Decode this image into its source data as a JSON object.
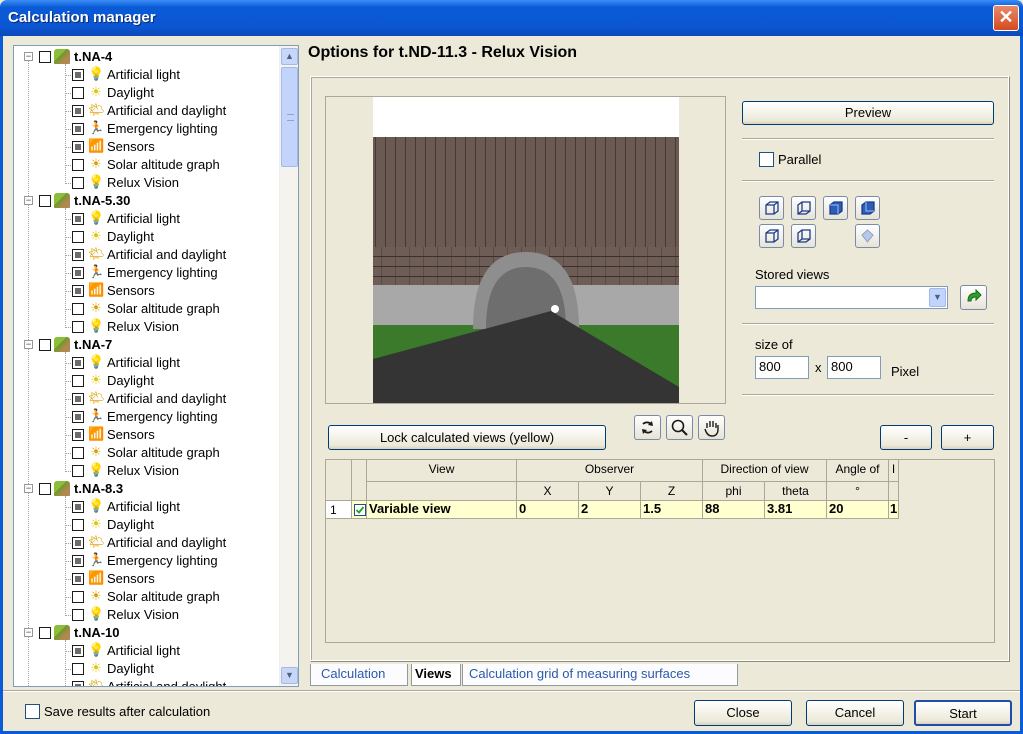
{
  "window": {
    "title": "Calculation manager"
  },
  "tree": {
    "projects": [
      {
        "label": "t.NA-4",
        "children": [
          "Artificial light",
          "Daylight",
          "Artificial and daylight",
          "Emergency lighting",
          "Sensors",
          "Solar altitude graph",
          "Relux Vision"
        ]
      },
      {
        "label": "t.NA-5.30",
        "children": [
          "Artificial light",
          "Daylight",
          "Artificial and daylight",
          "Emergency lighting",
          "Sensors",
          "Solar altitude graph",
          "Relux Vision"
        ]
      },
      {
        "label": "t.NA-7",
        "children": [
          "Artificial light",
          "Daylight",
          "Artificial and daylight",
          "Emergency lighting",
          "Sensors",
          "Solar altitude graph",
          "Relux Vision"
        ]
      },
      {
        "label": "t.NA-8.3",
        "children": [
          "Artificial light",
          "Daylight",
          "Artificial and daylight",
          "Emergency lighting",
          "Sensors",
          "Solar altitude graph",
          "Relux Vision"
        ]
      },
      {
        "label": "t.NA-10",
        "children": [
          "Artificial light",
          "Daylight",
          "Artificial and daylight"
        ]
      }
    ]
  },
  "options": {
    "heading": "Options for  t.ND-11.3 - Relux Vision"
  },
  "preview_button": "Preview",
  "parallel_label": "Parallel",
  "stored_views_label": "Stored views",
  "size": {
    "label": "size of",
    "width": "800",
    "times": "x",
    "height": "800",
    "unit": "Pixel"
  },
  "lock_button": "Lock calculated views (yellow)",
  "minus_button": "-",
  "plus_button": "+",
  "table": {
    "headers": {
      "view": "View",
      "observer": "Observer",
      "direction": "Direction of view",
      "angle": "Angle of",
      "x": "X",
      "y": "Y",
      "z": "Z",
      "phi": "phi",
      "theta": "theta",
      "deg": "°",
      "extra": "I"
    },
    "rows": [
      {
        "index": "1",
        "name": "Variable view",
        "x": "0",
        "y": "2",
        "z": "1.5",
        "phi": "88",
        "theta": "3.81",
        "angle": "20",
        "extra": "1"
      }
    ]
  },
  "tabs": [
    "Calculation",
    "Views",
    "Calculation grid of measuring surfaces"
  ],
  "save_label": "Save results after calculation",
  "buttons": {
    "close": "Close",
    "cancel": "Cancel",
    "start": "Start"
  },
  "colors": {
    "title_bar": "#0a5bd8",
    "selected_row": "#ffffd0",
    "dialog_bg": "#ece9d8"
  }
}
